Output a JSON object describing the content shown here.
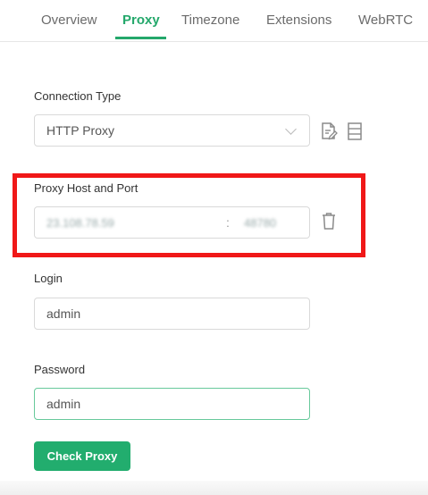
{
  "tabs": [
    {
      "label": "Overview",
      "active": false
    },
    {
      "label": "Proxy",
      "active": true
    },
    {
      "label": "Timezone",
      "active": false
    },
    {
      "label": "Extensions",
      "active": false
    },
    {
      "label": "WebRTC",
      "active": false
    }
  ],
  "connection": {
    "label": "Connection Type",
    "value": "HTTP Proxy"
  },
  "proxy_host": {
    "label": "Proxy Host and Port",
    "host_value": "23.108.78.59",
    "separator": ":",
    "port_value": "48780"
  },
  "login": {
    "label": "Login",
    "value": "admin"
  },
  "password": {
    "label": "Password",
    "value": "admin"
  },
  "check_button": {
    "label": "Check Proxy"
  },
  "colors": {
    "accent": "#24a86b",
    "highlight": "#f01818"
  }
}
